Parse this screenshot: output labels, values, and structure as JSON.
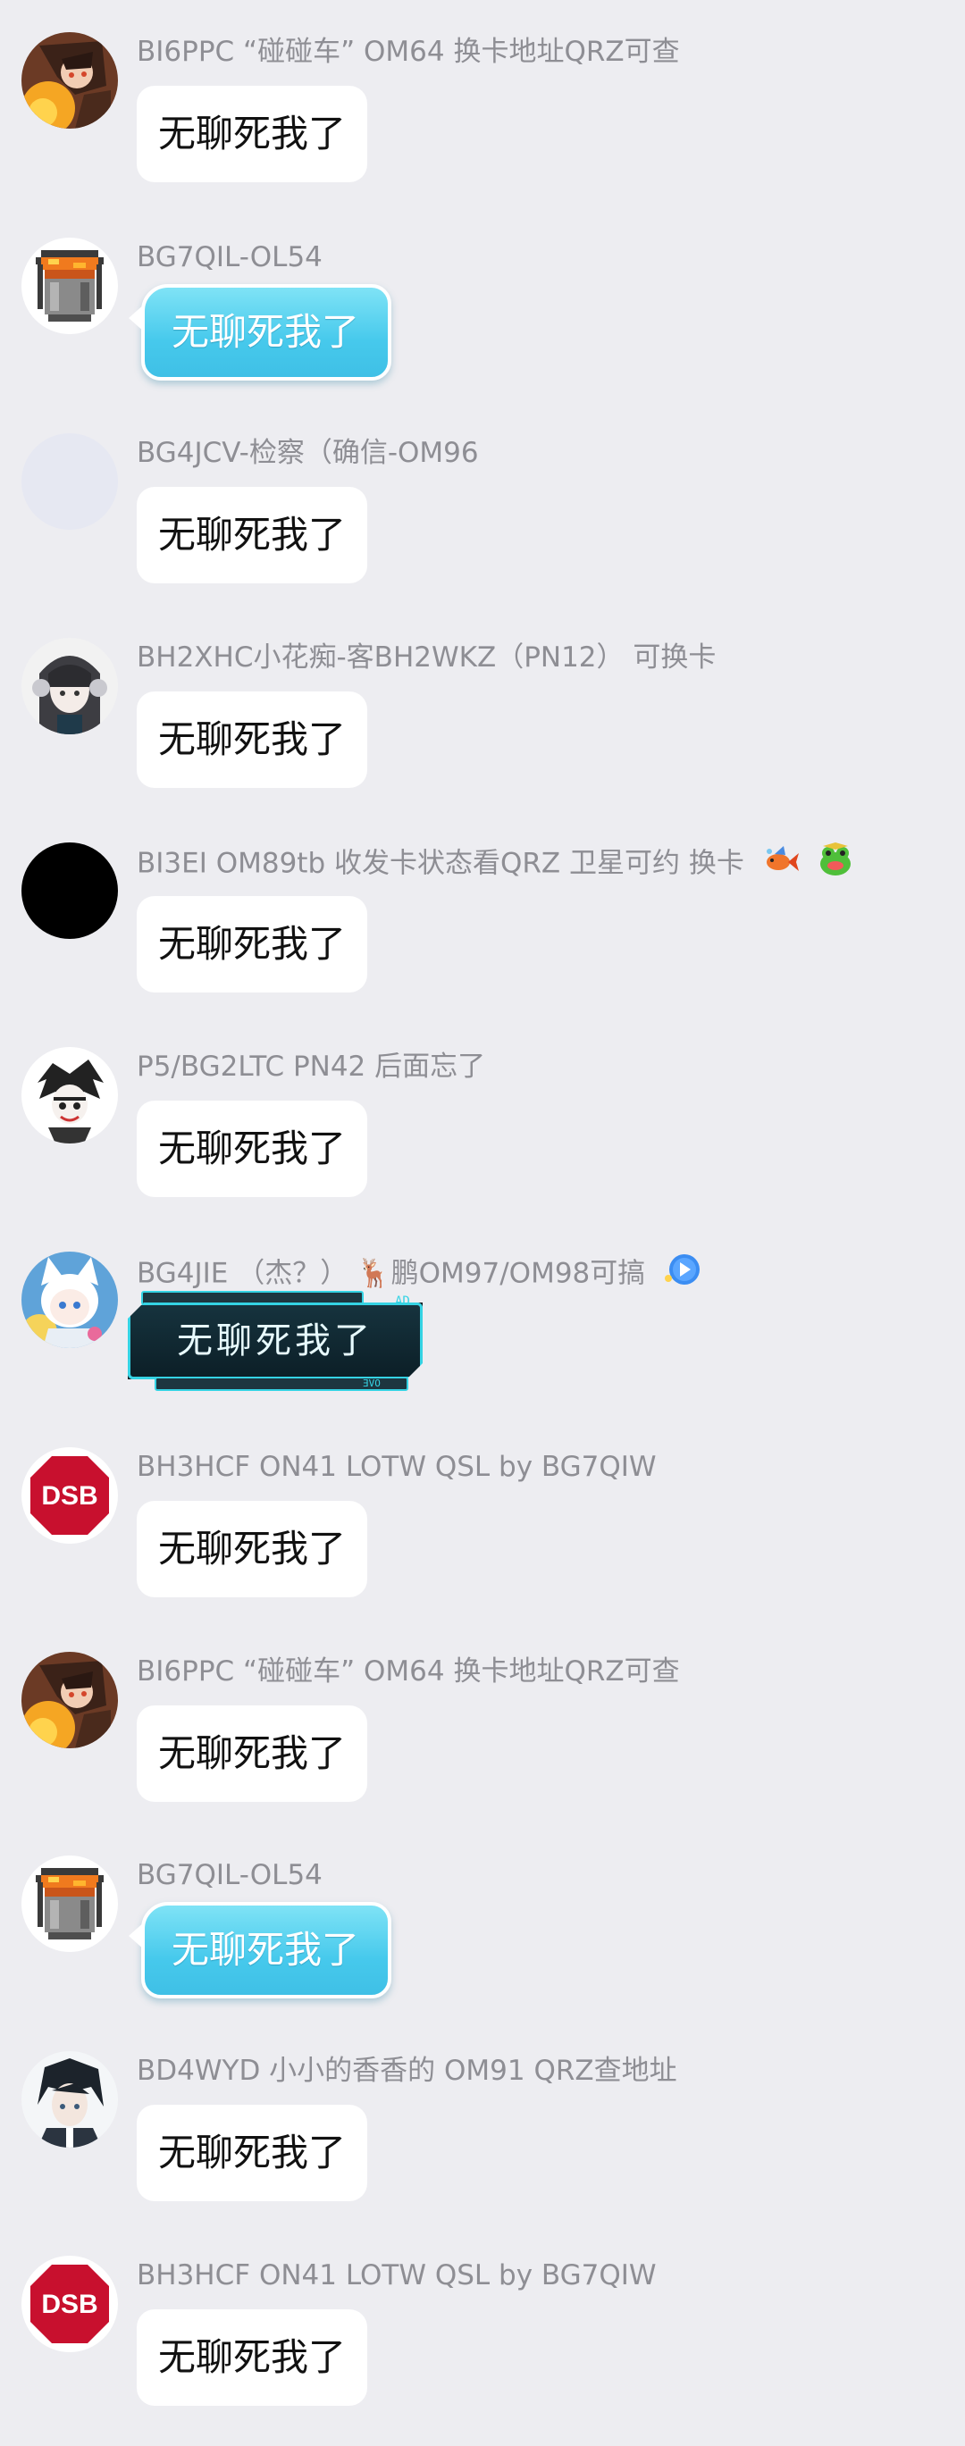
{
  "colors": {
    "background": "#ededf1",
    "bubble_white": "#ffffff",
    "bubble_cyan": "#46c9ec",
    "name_gray": "#8e8e94",
    "dsb_red": "#c8102e"
  },
  "messages": [
    {
      "sender": "BI6PPC “碰碰车” OM64 换卡地址QRZ可查",
      "text": "无聊死我了",
      "avatar": "anime-fire-avatar",
      "bubble": "white"
    },
    {
      "sender": "BG7QIL-OL54",
      "text": "无聊死我了",
      "avatar": "pixel-lava-bucket-avatar",
      "bubble": "cyan"
    },
    {
      "sender": "BG4JCV-检察（确信-OM96",
      "text": "无聊死我了",
      "avatar": "blank-avatar",
      "bubble": "white"
    },
    {
      "sender": "BH2XHC小花痴-客BH2WKZ（PN12） 可换卡",
      "text": "无聊死我了",
      "avatar": "anime-girl-headphones-avatar",
      "bubble": "white"
    },
    {
      "sender": "BI3EI OM89tb 收发卡状态看QRZ 卫星可约 换卡",
      "text": "无聊死我了",
      "avatar": "black-circle-avatar",
      "bubble": "white",
      "badges": [
        "goldfish-badge",
        "frog-badge"
      ]
    },
    {
      "sender": "P5/BG2LTC PN42 后面忘了",
      "text": "无聊死我了",
      "avatar": "sketch-character-avatar",
      "bubble": "white"
    },
    {
      "sender": "BG4JIE （杰？） 🦌鹏OM97/OM98可搞",
      "text": "无聊死我了",
      "avatar": "white-cat-girl-avatar",
      "bubble": "tech",
      "tech_marks": [
        "AD",
        "OVE"
      ],
      "badges": [
        "play-badge"
      ]
    },
    {
      "sender": "BH3HCF ON41 LOTW QSL by BG7QIW",
      "text": "无聊死我了",
      "avatar": "dsb-logo-avatar",
      "avatar_text": "DSB",
      "bubble": "white"
    },
    {
      "sender": "BI6PPC “碰碰车” OM64 换卡地址QRZ可查",
      "text": "无聊死我了",
      "avatar": "anime-fire-avatar",
      "bubble": "white"
    },
    {
      "sender": "BG7QIL-OL54",
      "text": "无聊死我了",
      "avatar": "pixel-lava-bucket-avatar",
      "bubble": "cyan"
    },
    {
      "sender": "BD4WYD 小小的香香的 OM91 QRZ查地址",
      "text": "无聊死我了",
      "avatar": "anime-boy-avatar",
      "bubble": "white"
    },
    {
      "sender": "BH3HCF ON41 LOTW QSL by BG7QIW",
      "text": "无聊死我了",
      "avatar": "dsb-logo-avatar",
      "avatar_text": "DSB",
      "bubble": "white"
    }
  ]
}
